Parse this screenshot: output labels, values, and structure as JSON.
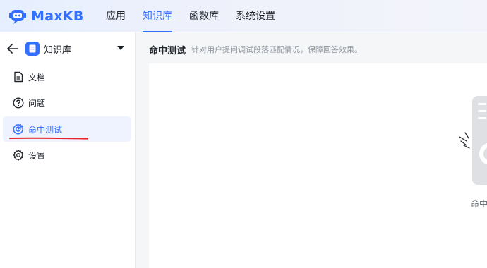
{
  "app": {
    "logo_text": "MaxKB",
    "nav": [
      {
        "label": "应用",
        "active": false
      },
      {
        "label": "知识库",
        "active": true
      },
      {
        "label": "函数库",
        "active": false
      },
      {
        "label": "系统设置",
        "active": false
      }
    ],
    "accent_color": "#3370ff"
  },
  "sidebar": {
    "kb_title": "知识库",
    "items": [
      {
        "label": "文档",
        "icon": "document-icon",
        "active": false
      },
      {
        "label": "问题",
        "icon": "question-icon",
        "active": false
      },
      {
        "label": "命中测试",
        "icon": "target-icon",
        "active": true
      },
      {
        "label": "设置",
        "icon": "gear-icon",
        "active": false
      }
    ]
  },
  "main": {
    "title": "命中测试",
    "description": "针对用户提问调试段落匹配情况，保障回答效果。",
    "empty_text": "命中"
  }
}
